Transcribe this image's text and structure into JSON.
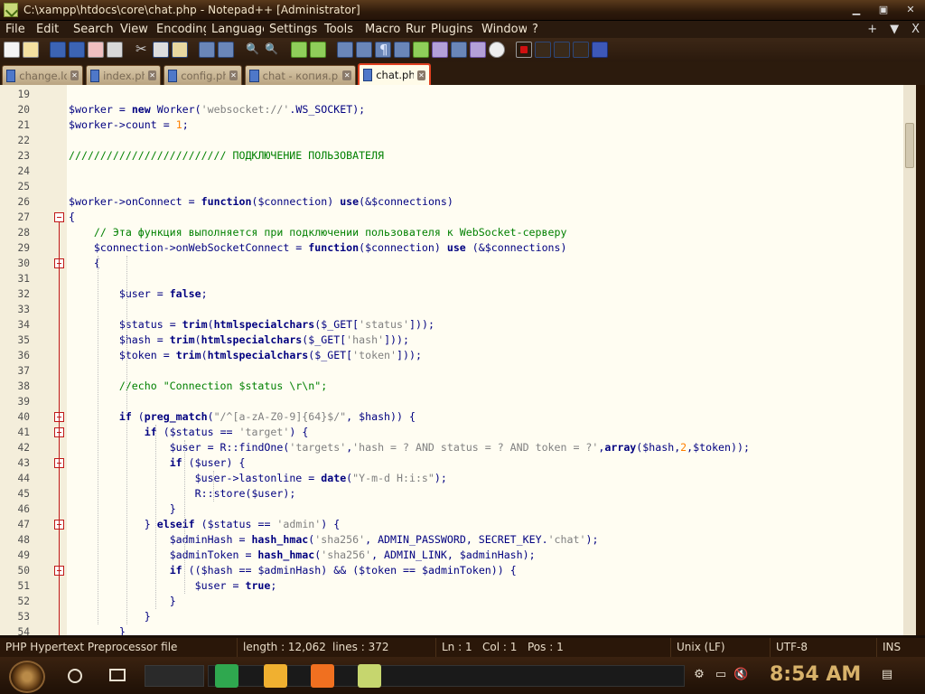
{
  "window": {
    "title": "C:\\xampp\\htdocs\\core\\chat.php - Notepad++ [Administrator]",
    "minimize_icon": "minimize-icon",
    "maximize_icon": "maximize-icon",
    "close_icon": "close-icon"
  },
  "menubar": {
    "items": [
      "File",
      "Edit",
      "Search",
      "View",
      "Encoding",
      "Language",
      "Settings",
      "Tools",
      "Macro",
      "Run",
      "Plugins",
      "Window",
      "?"
    ],
    "right_plus": "+",
    "right_down": "▼",
    "right_close": "X"
  },
  "toolbar": {
    "icons": [
      "new-file-icon",
      "open-file-icon",
      "save-icon",
      "save-all-icon",
      "close-icon",
      "close-all-icon",
      "print-icon",
      "cut-icon",
      "copy-icon",
      "paste-icon",
      "undo-icon",
      "redo-icon",
      "find-icon",
      "replace-icon",
      "zoom-in-icon",
      "zoom-out-icon",
      "sync-scroll-icon",
      "word-wrap-icon",
      "show-all-chars-icon",
      "indent-guide-icon",
      "language-icon",
      "doc-map-icon",
      "function-list-icon",
      "folder-workspace-icon",
      "monitoring-icon",
      "record-macro-icon",
      "stop-macro-icon",
      "play-macro-icon",
      "run-macro-multiple-icon",
      "save-macro-icon"
    ]
  },
  "tabs": [
    {
      "label": "change.log",
      "active": false
    },
    {
      "label": "index.php",
      "active": false
    },
    {
      "label": "config.php",
      "active": false
    },
    {
      "label": "chat - копия.php",
      "active": false
    },
    {
      "label": "chat.php",
      "active": true
    }
  ],
  "editor": {
    "lines": [
      {
        "n": "19",
        "code": ""
      },
      {
        "n": "20",
        "code": "$worker = new Worker('websocket://'.WS_SOCKET);"
      },
      {
        "n": "21",
        "code": "$worker->count = 1;"
      },
      {
        "n": "22",
        "code": ""
      },
      {
        "n": "23",
        "code": "///////////////////////// ПОДКЛЮЧЕНИЕ ПОЛЬЗОВАТЕЛЯ"
      },
      {
        "n": "24",
        "code": ""
      },
      {
        "n": "25",
        "code": ""
      },
      {
        "n": "26",
        "code": "$worker->onConnect = function($connection) use(&$connections)"
      },
      {
        "n": "27",
        "code": "{"
      },
      {
        "n": "28",
        "code": "    // Эта функция выполняется при подключении пользователя к WebSocket-серверу"
      },
      {
        "n": "29",
        "code": "    $connection->onWebSocketConnect = function($connection) use (&$connections)"
      },
      {
        "n": "30",
        "code": "    {"
      },
      {
        "n": "31",
        "code": ""
      },
      {
        "n": "32",
        "code": "        $user = false;"
      },
      {
        "n": "33",
        "code": ""
      },
      {
        "n": "34",
        "code": "        $status = trim(htmlspecialchars($_GET['status']));"
      },
      {
        "n": "35",
        "code": "        $hash = trim(htmlspecialchars($_GET['hash']));"
      },
      {
        "n": "36",
        "code": "        $token = trim(htmlspecialchars($_GET['token']));"
      },
      {
        "n": "37",
        "code": ""
      },
      {
        "n": "38",
        "code": "        //echo \"Connection $status \\r\\n\";"
      },
      {
        "n": "39",
        "code": ""
      },
      {
        "n": "40",
        "code": "        if (preg_match(\"/^[a-zA-Z0-9]{64}$/\", $hash)) {"
      },
      {
        "n": "41",
        "code": "            if ($status == 'target') {"
      },
      {
        "n": "42",
        "code": "                $user = R::findOne('targets','hash = ? AND status = ? AND token = ?',array($hash,2,$token));"
      },
      {
        "n": "43",
        "code": "                if ($user) {"
      },
      {
        "n": "44",
        "code": "                    $user->lastonline = date(\"Y-m-d H:i:s\");"
      },
      {
        "n": "45",
        "code": "                    R::store($user);"
      },
      {
        "n": "46",
        "code": "                }"
      },
      {
        "n": "47",
        "code": "            } elseif ($status == 'admin') {"
      },
      {
        "n": "48",
        "code": "                $adminHash = hash_hmac('sha256', ADMIN_PASSWORD, SECRET_KEY.'chat');"
      },
      {
        "n": "49",
        "code": "                $adminToken = hash_hmac('sha256', ADMIN_LINK, $adminHash);"
      },
      {
        "n": "50",
        "code": "                if (($hash == $adminHash) && ($token == $adminToken)) {"
      },
      {
        "n": "51",
        "code": "                    $user = true;"
      },
      {
        "n": "52",
        "code": "                }"
      },
      {
        "n": "53",
        "code": "            }"
      },
      {
        "n": "54",
        "code": "        }"
      }
    ]
  },
  "statusbar": {
    "filetype": "PHP Hypertext Preprocessor file",
    "length": "length : 12,062",
    "lines": "lines : 372",
    "ln": "Ln : 1",
    "col": "Col : 1",
    "pos": "Pos : 1",
    "eol": "Unix (LF)",
    "encoding": "UTF-8",
    "mode": "INS"
  },
  "taskbar": {
    "clock": "8:54 AM",
    "apps": [
      "notes-app-icon",
      "file-explorer-icon",
      "xampp-icon",
      "notepadpp-icon"
    ]
  },
  "colors": {
    "keyword": "#000080",
    "string": "#808080",
    "number": "#ff8000",
    "comment": "#008000",
    "fold_marker": "#c01818",
    "active_tab_border": "#e04020",
    "clock": "#d8b26a"
  }
}
